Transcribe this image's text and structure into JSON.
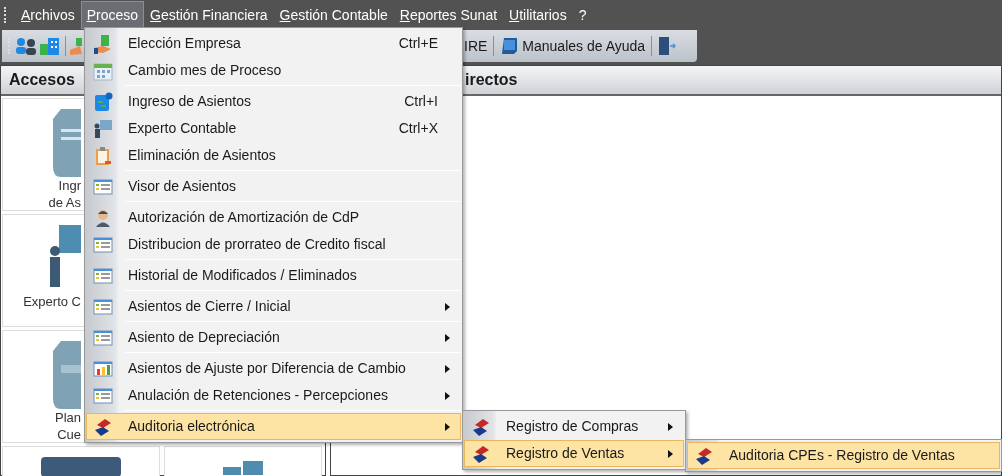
{
  "menubar": {
    "items": [
      {
        "label": "Archivos",
        "mnemonic": true,
        "selected": false
      },
      {
        "label": "Proceso",
        "mnemonic": true,
        "selected": true
      },
      {
        "label": "Gestión Financiera",
        "mnemonic": true,
        "selected": false
      },
      {
        "label": "Gestión Contable",
        "mnemonic": true,
        "selected": false
      },
      {
        "label": "Reportes Sunat",
        "mnemonic": true,
        "selected": false
      },
      {
        "label": "Utilitarios",
        "mnemonic": true,
        "selected": false
      },
      {
        "label": "?",
        "mnemonic": false,
        "selected": false
      }
    ]
  },
  "toolbar": {
    "buttons": [
      {
        "label": "IRE"
      },
      {
        "label": "Manuales de Ayuda"
      }
    ]
  },
  "left_panel": {
    "title": "Accesos",
    "cards": [
      {
        "lines": [
          "Ingr",
          "de As"
        ]
      },
      {
        "lines": [
          "Experto C"
        ]
      },
      {
        "lines": [
          "Plan",
          "Cue"
        ]
      }
    ]
  },
  "right_panel": {
    "title": "irectos"
  },
  "menu": {
    "items": [
      {
        "label": "Elección Empresa",
        "shortcut": "Ctrl+E",
        "submenu": false,
        "separator_before": false,
        "selected": false
      },
      {
        "label": "Cambio mes de Proceso",
        "submenu": false,
        "separator_before": false,
        "selected": false
      },
      {
        "label": "Ingreso de Asientos",
        "shortcut": "Ctrl+I",
        "submenu": false,
        "separator_before": true,
        "selected": false
      },
      {
        "label": "Experto Contable",
        "shortcut": "Ctrl+X",
        "submenu": false,
        "separator_before": false,
        "selected": false
      },
      {
        "label": "Eliminación de Asientos",
        "submenu": false,
        "separator_before": false,
        "selected": false
      },
      {
        "label": "Visor de Asientos",
        "submenu": false,
        "separator_before": true,
        "selected": false
      },
      {
        "label": "Autorización de Amortización de CdP",
        "submenu": false,
        "separator_before": true,
        "selected": false
      },
      {
        "label": "Distribucion de prorrateo de Credito fiscal",
        "submenu": false,
        "separator_before": false,
        "selected": false
      },
      {
        "label": "Historial de Modificados / Eliminados",
        "submenu": false,
        "separator_before": true,
        "selected": false
      },
      {
        "label": "Asientos de Cierre / Inicial",
        "submenu": true,
        "separator_before": true,
        "selected": false
      },
      {
        "label": "Asiento de Depreciación",
        "submenu": true,
        "separator_before": true,
        "selected": false
      },
      {
        "label": "Asientos de Ajuste por Diferencia de Cambio",
        "submenu": true,
        "separator_before": true,
        "selected": false
      },
      {
        "label": "Anulación de Retenciones - Percepciones",
        "submenu": true,
        "separator_before": false,
        "selected": false
      },
      {
        "label": "Auditoria electrónica",
        "submenu": true,
        "separator_before": true,
        "selected": true,
        "children": [
          {
            "label": "Registro de Compras",
            "submenu": true,
            "selected": false
          },
          {
            "label": "Registro de Ventas",
            "submenu": true,
            "selected": true,
            "children": [
              {
                "label": "Auditoria CPEs - Registro de Ventas",
                "selected": true
              }
            ]
          }
        ]
      }
    ]
  }
}
